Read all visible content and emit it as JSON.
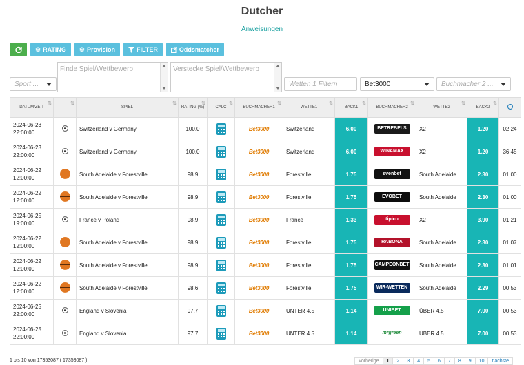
{
  "title": "Dutcher",
  "sublink": "Anweisungen",
  "toolbar": {
    "rating": "RATING",
    "provision": "Provision",
    "filter": "FILTER",
    "oddsmatcher": "Oddsmatcher"
  },
  "filters": {
    "sport_placeholder": "Sport ...",
    "find_placeholder": "Finde Spiel/Wettbewerb",
    "hide_placeholder": "Verstecke Spiel/Wettbewerb",
    "bet1_placeholder": "Wetten 1 Filtern",
    "bookmaker1_value": "Bet3000",
    "bookmaker2_placeholder": "Buchmacher 2 ..."
  },
  "columns": [
    "DATUM/ZEIT",
    "",
    "SPIEL",
    "RATING (%)",
    "CALC",
    "BUCHMACHER1",
    "WETTE1",
    "BACK1",
    "BUCHMACHER2",
    "WETTE2",
    "BACK2",
    ""
  ],
  "rows": [
    {
      "date": "2024-06-23",
      "time": "22:00:00",
      "sport": "football",
      "game": "Switzerland v Germany",
      "rating": "100.0",
      "bm1": "Bet3000",
      "bet1": "Switzerland",
      "back1": "6.00",
      "bm2": "BETREBELS",
      "bm2_bg": "#1a1a1a",
      "bet2": "X2",
      "back2": "1.20",
      "clock": "02:24"
    },
    {
      "date": "2024-06-23",
      "time": "22:00:00",
      "sport": "football",
      "game": "Switzerland v Germany",
      "rating": "100.0",
      "bm1": "Bet3000",
      "bet1": "Switzerland",
      "back1": "6.00",
      "bm2": "WINAMAX",
      "bm2_bg": "#c8102e",
      "bet2": "X2",
      "back2": "1.20",
      "clock": "36:45"
    },
    {
      "date": "2024-06-22",
      "time": "12:00:00",
      "sport": "basketball",
      "game": "South Adelaide v Forestville",
      "rating": "98.9",
      "bm1": "Bet3000",
      "bet1": "Forestville",
      "back1": "1.75",
      "bm2": "svenbet",
      "bm2_bg": "#111111",
      "bet2": "South Adelaide",
      "back2": "2.30",
      "clock": "01:00"
    },
    {
      "date": "2024-06-22",
      "time": "12:00:00",
      "sport": "basketball",
      "game": "South Adelaide v Forestville",
      "rating": "98.9",
      "bm1": "Bet3000",
      "bet1": "Forestville",
      "back1": "1.75",
      "bm2": "EVOBET",
      "bm2_bg": "#0d0d0d",
      "bet2": "South Adelaide",
      "back2": "2.30",
      "clock": "01:00"
    },
    {
      "date": "2024-06-25",
      "time": "19:00:00",
      "sport": "football",
      "game": "France v Poland",
      "rating": "98.9",
      "bm1": "Bet3000",
      "bet1": "France",
      "back1": "1.33",
      "bm2": "tipico",
      "bm2_bg": "#c8102e",
      "bet2": "X2",
      "back2": "3.90",
      "clock": "01:21"
    },
    {
      "date": "2024-06-22",
      "time": "12:00:00",
      "sport": "basketball",
      "game": "South Adelaide v Forestville",
      "rating": "98.9",
      "bm1": "Bet3000",
      "bet1": "Forestville",
      "back1": "1.75",
      "bm2": "RABONA",
      "bm2_bg": "#b3122a",
      "bet2": "South Adelaide",
      "back2": "2.30",
      "clock": "01:07"
    },
    {
      "date": "2024-06-22",
      "time": "12:00:00",
      "sport": "basketball",
      "game": "South Adelaide v Forestville",
      "rating": "98.9",
      "bm1": "Bet3000",
      "bet1": "Forestville",
      "back1": "1.75",
      "bm2": "CAMPEONBET",
      "bm2_bg": "#111111",
      "bet2": "South Adelaide",
      "back2": "2.30",
      "clock": "01:01"
    },
    {
      "date": "2024-06-22",
      "time": "12:00:00",
      "sport": "basketball",
      "game": "South Adelaide v Forestville",
      "rating": "98.6",
      "bm1": "Bet3000",
      "bet1": "Forestville",
      "back1": "1.75",
      "bm2": "WIR-WETTEN",
      "bm2_bg": "#0a2a5c",
      "bet2": "South Adelaide",
      "back2": "2.29",
      "clock": "00:53"
    },
    {
      "date": "2024-06-25",
      "time": "22:00:00",
      "sport": "football",
      "game": "England v Slovenia",
      "rating": "97.7",
      "bm1": "Bet3000",
      "bet1": "UNTER 4.5",
      "back1": "1.14",
      "bm2": "UNIBET",
      "bm2_bg": "#14a04a",
      "bet2": "ÜBER 4.5",
      "back2": "7.00",
      "clock": "00:53"
    },
    {
      "date": "2024-06-25",
      "time": "22:00:00",
      "sport": "football",
      "game": "England v Slovenia",
      "rating": "97.7",
      "bm1": "Bet3000",
      "bet1": "UNTER 4.5",
      "back1": "1.14",
      "bm2": "mrgreen",
      "bm2_bg": "#ffffff",
      "bet2": "ÜBER 4.5",
      "back2": "7.00",
      "clock": "00:53"
    }
  ],
  "info": "1 bis 10 von 17353087 ( 17353087 )",
  "pager": [
    "vorherige",
    "1",
    "2",
    "3",
    "4",
    "5",
    "6",
    "7",
    "8",
    "9",
    "10",
    "nächste"
  ],
  "colors": {
    "accent": "#18b5b5",
    "green_btn": "#4cae4c",
    "blue_btn": "#5bc0de"
  }
}
